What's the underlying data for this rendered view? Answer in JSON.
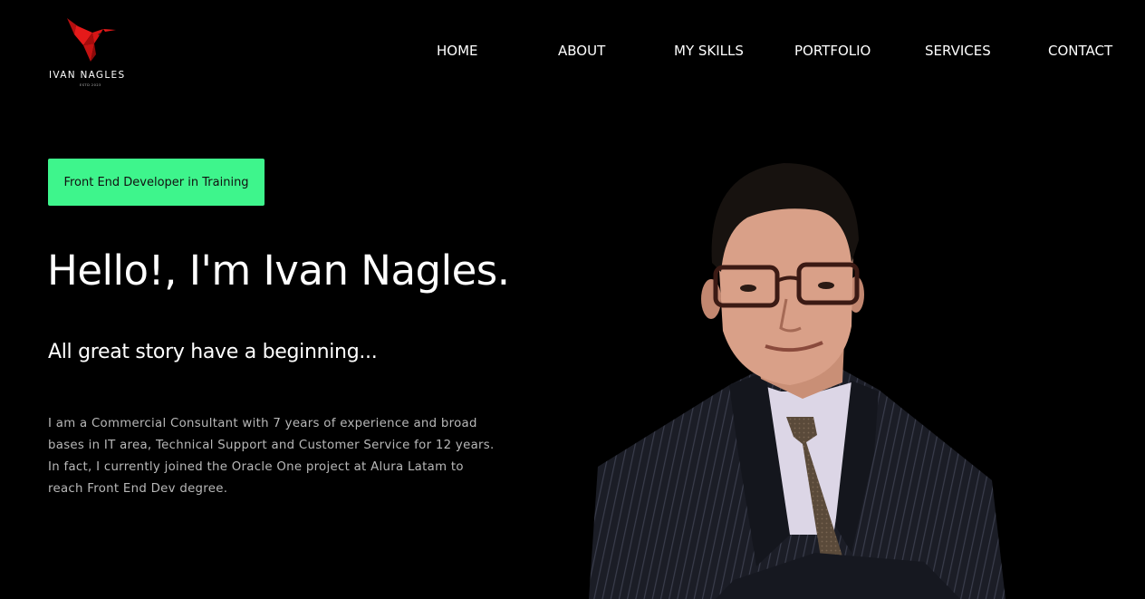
{
  "logo": {
    "name": "IVAN NAGLES",
    "tagline": "ESTD 2023",
    "icon": "hummingbird-icon",
    "color": "#e51a1a"
  },
  "nav": {
    "items": [
      {
        "label": "HOME"
      },
      {
        "label": "ABOUT"
      },
      {
        "label": "MY SKILLS"
      },
      {
        "label": "PORTFOLIO"
      },
      {
        "label": "SERVICES"
      },
      {
        "label": "CONTACT"
      }
    ]
  },
  "hero": {
    "badge": "Front End Developer in Training",
    "title": "Hello!, I'm Ivan Nagles.",
    "subtitle": "All great story have a beginning...",
    "body": "I am a Commercial Consultant with 7 years of experience and broad bases in IT area, Technical Support and Customer Service for 12 years. In fact, I currently joined the Oracle One project at Alura Latam to reach Front End Dev degree."
  },
  "colors": {
    "background": "#000000",
    "accent": "#3ef58c",
    "brand": "#e51a1a"
  }
}
